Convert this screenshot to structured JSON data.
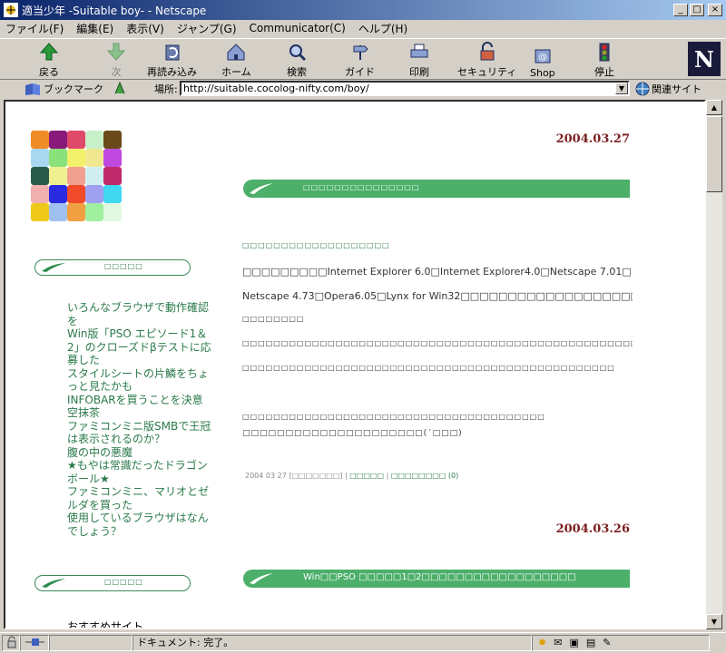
{
  "window": {
    "title": "適当少年 -Suitable boy- - Netscape"
  },
  "menu": [
    "ファイル(F)",
    "編集(E)",
    "表示(V)",
    "ジャンプ(G)",
    "Communicator(C)",
    "ヘルプ(H)"
  ],
  "toolbar": {
    "back": "戻る",
    "forward": "次",
    "reload": "再読み込み",
    "home": "ホーム",
    "search": "検索",
    "guide": "ガイド",
    "print": "印刷",
    "security": "セキュリティ",
    "shop": "Shop",
    "stop": "停止"
  },
  "location": {
    "bookmarks": "ブックマーク",
    "label": "場所:",
    "url": "http://suitable.cocolog-nifty.com/boy/",
    "related": "関連サイト"
  },
  "sidebar": {
    "head1": "□□□□□",
    "recent_entries": [
      "いろんなブラウザで動作確認を",
      "Win版「PSO エピソード1＆2」のクローズドβテストに応募した",
      "スタイルシートの片鱗をちょっと見たかも",
      "INFOBARを買うことを決意",
      "空抹茶",
      "ファミコンミニ版SMBで王冠は表示されるのか？",
      "腹の中の悪魔",
      "★もやは常識だったドラゴンボール★",
      "ファミコンミニ、マリオとゼルダを買った",
      "使用しているブラウザはなんでしょう？"
    ],
    "head2": "□□□□□",
    "recommend": "おすすめサイト"
  },
  "entries": [
    {
      "date": "2004.03.27",
      "title": "□□□□□□□□□□□□□□□",
      "lines": [
        "□□□□□□□□□□□□□□□□□□□",
        "□□□□□□□□□Internet Explorer 6.0□Internet Explorer4.0□Netscape 7.01□",
        "Netscape 4.73□Opera6.05□Lynx for Win32□□□□□□□□□□□□□□□□□□□□□□□□□□",
        "□□□□□□□□",
        "□□□□□□□□□□□□□□□□□□□□□□□□□□□□□□□□□□□□□□□□□□□□□□□□□□□□□□□□",
        "□□□□□□□□□□□□□□□□□□□□□□□□□□□□□□□□□□□□□□□□□□□□□□□□",
        "□□□□□□□□□□□□□□□□□□□□□□□□□□□□□□□□□□□□□□□",
        "□□□□□□□□□□□□□□□□□□□□□(´□□□)"
      ],
      "meta_time": "2004 03 27 [□□□□□□□]",
      "meta_link1": "□□□□□",
      "meta_link2": "□□□□□□□□ (0)"
    },
    {
      "date": "2004.03.26",
      "title": "Win□□PSO □□□□□1□2□□□□□□□□□□□□□□□□□□"
    }
  ],
  "status": {
    "text": "ドキュメント: 完了。"
  }
}
